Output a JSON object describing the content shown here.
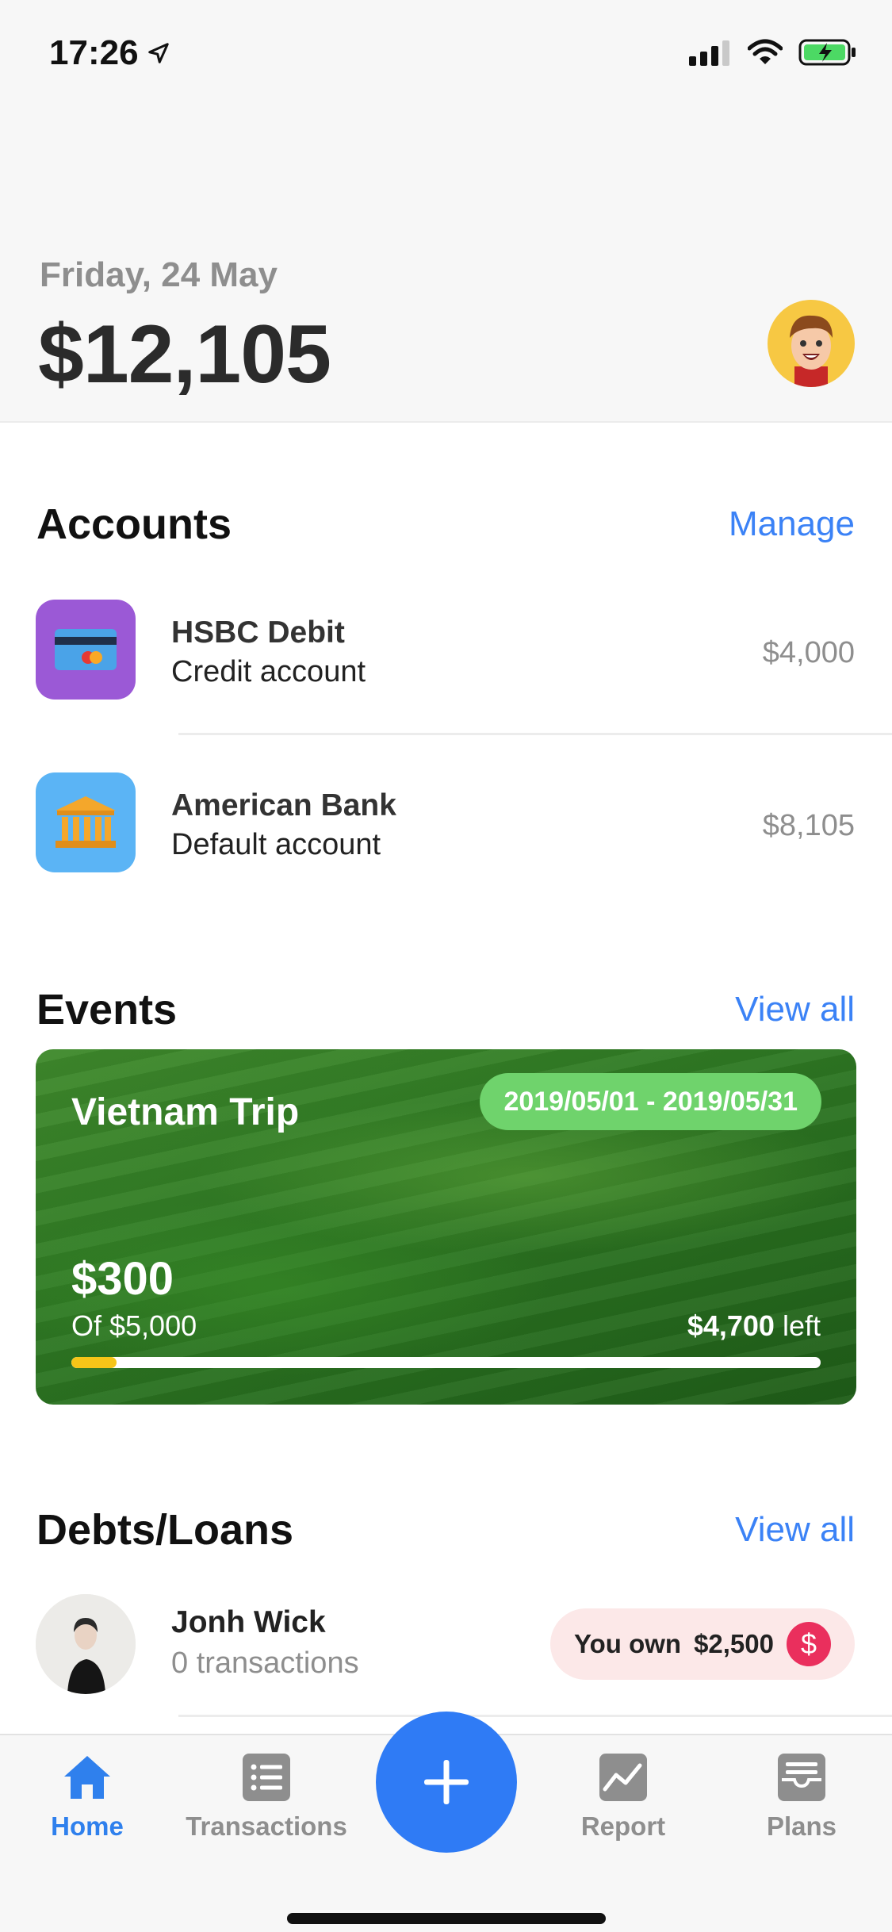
{
  "status_bar": {
    "time": "17:26"
  },
  "header": {
    "date": "Friday, 24 May",
    "balance": "$12,105"
  },
  "accounts": {
    "title": "Accounts",
    "manage_label": "Manage",
    "items": [
      {
        "name": "HSBC Debit",
        "type": "Credit account",
        "amount": "$4,000",
        "icon": "credit-card-icon",
        "color": "#9b59d6"
      },
      {
        "name": "American Bank",
        "type": "Default account",
        "amount": "$8,105",
        "icon": "bank-icon",
        "color": "#5bb4f5"
      }
    ]
  },
  "events": {
    "title": "Events",
    "view_all_label": "View all",
    "card": {
      "name": "Vietnam Trip",
      "dates": "2019/05/01 - 2019/05/31",
      "spent": "$300",
      "of_total": "Of $5,000",
      "left_amount": "$4,700",
      "left_label": "left",
      "progress": 0.06
    }
  },
  "debts": {
    "title": "Debts/Loans",
    "view_all_label": "View all",
    "items": [
      {
        "name": "Jonh Wick",
        "transactions": "0 transactions",
        "label": "You own",
        "amount": "$2,500",
        "symbol": "$"
      }
    ]
  },
  "tabbar": {
    "items": [
      {
        "label": "Home",
        "icon": "home-icon",
        "active": true
      },
      {
        "label": "Transactions",
        "icon": "list-icon",
        "active": false
      },
      {
        "label": "Report",
        "icon": "report-chart-icon",
        "active": false
      },
      {
        "label": "Plans",
        "icon": "inbox-tray-icon",
        "active": false
      }
    ],
    "add_icon": "plus-icon"
  },
  "colors": {
    "accent": "#3b82f6",
    "tab_active": "#2f80ed",
    "event_badge": "#6fd36c",
    "debt_badge_bg": "#fce8e8",
    "debt_dollar": "#ea2f5d"
  }
}
